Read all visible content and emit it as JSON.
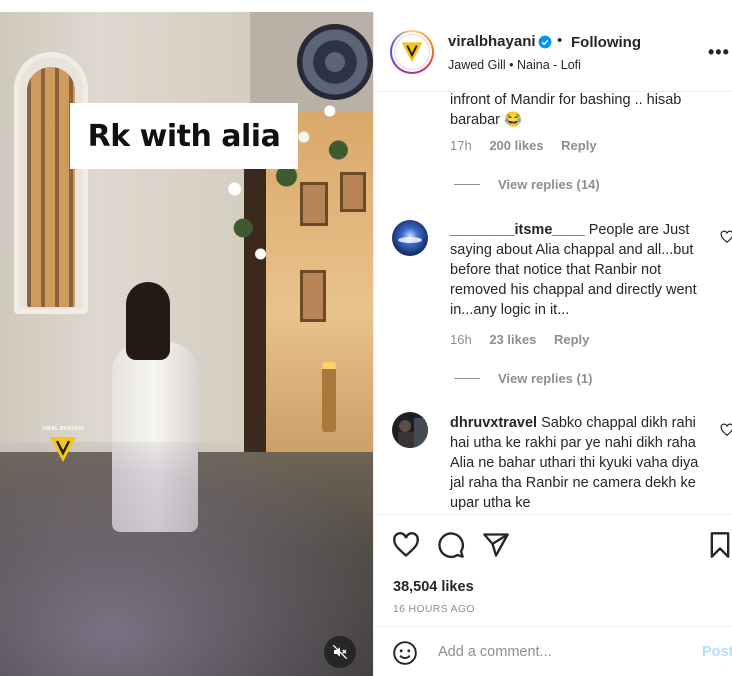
{
  "media": {
    "caption_overlay": "Rk with alia",
    "watermark_text": "VIRAL BHAYANI",
    "mute_icon": "volume-muted-icon"
  },
  "header": {
    "username": "viralbhayani",
    "verified_icon": "verified-badge-icon",
    "separator": "•",
    "follow_status": "Following",
    "audio": "Jawed Gill • Naina - Lofi",
    "more_icon": "more-options-icon"
  },
  "comments": [
    {
      "text_tail": "infront of Mandir for bashing .. hisab barabar 😂",
      "time": "17h",
      "likes": "200 likes",
      "reply": "Reply",
      "view_replies": "View replies (14)"
    },
    {
      "user": "________itsme____",
      "text": "People are Just saying about Alia chappal and all...but before that notice that Ranbir not removed his chappal and directly went in...any logic in it...",
      "time": "16h",
      "likes": "23 likes",
      "reply": "Reply",
      "view_replies": "View replies (1)"
    },
    {
      "user": "dhruvxtravel",
      "text": "Sabko chappal dikh rahi hai utha ke rakhi par ye nahi dikh raha Alia ne bahar uthari thi kyuki vaha diya jal raha tha Ranbir ne camera dekh ke upar utha ke"
    }
  ],
  "actions": {
    "like_icon": "heart-icon",
    "comment_icon": "comment-icon",
    "share_icon": "share-icon",
    "save_icon": "bookmark-icon",
    "likes_count": "38,504 likes",
    "time_ago": "16 HOURS AGO"
  },
  "add_comment": {
    "placeholder": "Add a comment...",
    "post_label": "Post",
    "emoji_icon": "emoji-icon"
  },
  "colors": {
    "accent_blue": "#0095f6",
    "post_disabled": "#b2dffc",
    "muted_text": "#8e8e8e",
    "text": "#262626"
  }
}
